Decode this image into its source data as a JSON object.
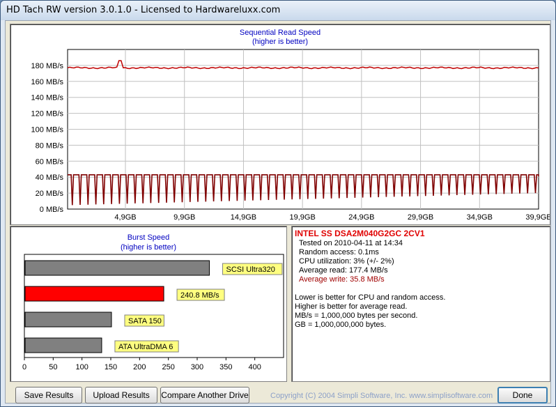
{
  "window": {
    "title": "HD Tach RW version 3.0.1.0 - Licensed to Hardwareluxx.com"
  },
  "sequential": {
    "title": "Sequential Read Speed",
    "subtitle": "(higher is better)"
  },
  "burst": {
    "title": "Burst Speed",
    "subtitle": "(higher is better)"
  },
  "info": {
    "drive_name": "INTEL SS DSA2M040G2GC 2CV1",
    "tested_on": "Tested on 2010-04-11 at 14:34",
    "random_access": "Random access: 0.1ms",
    "cpu_utilization": "CPU utilization: 3% (+/- 2%)",
    "average_read": "Average read: 177.4 MB/s",
    "average_write": "Average write: 35.8 MB/s",
    "notes": [
      "Lower is better for CPU and random access.",
      "Higher is better for average read.",
      "MB/s = 1,000,000 bytes per second.",
      "GB = 1,000,000,000 bytes."
    ]
  },
  "buttons": {
    "save": "Save Results",
    "upload": "Upload Results",
    "compare": "Compare Another Drive",
    "done": "Done"
  },
  "copyright": "Copyright (C) 2004 Simpli Software, Inc. www.simplisoftware.com",
  "colors": {
    "read": "#c00000",
    "write": "#800000",
    "bar_gray": "#808080",
    "bar_red": "#ff0000",
    "label_bg": "#ffff80"
  },
  "chart_data": [
    {
      "type": "line",
      "title": "Sequential Read Speed",
      "subtitle": "(higher is better)",
      "ylim": [
        0,
        200
      ],
      "y_ticks": [
        "0 MB/s",
        "20 MB/s",
        "40 MB/s",
        "60 MB/s",
        "80 MB/s",
        "100 MB/s",
        "120 MB/s",
        "140 MB/s",
        "160 MB/s",
        "180 MB/s"
      ],
      "x_ticks": [
        "4,9GB",
        "9,9GB",
        "14,9GB",
        "19,9GB",
        "24,9GB",
        "29,9GB",
        "34,9GB",
        "39,9GB"
      ],
      "xlim": [
        0,
        39.9
      ],
      "series": [
        {
          "read_level": 177,
          "read_spike": {
            "x": 4.5,
            "y": 186
          }
        },
        {
          "write_high": 43,
          "write_low_start": 5,
          "write_low_end": 20,
          "write_periods": 60
        }
      ]
    },
    {
      "type": "bar",
      "title": "Burst Speed",
      "subtitle": "(higher is better)",
      "xlim": [
        0,
        450
      ],
      "x_ticks": [
        "0",
        "50",
        "100",
        "150",
        "200",
        "250",
        "300",
        "350",
        "400"
      ],
      "bars": [
        {
          "label": "SCSI Ultra320",
          "value": 320,
          "highlight": false
        },
        {
          "label": "240.8 MB/s",
          "value": 240.8,
          "highlight": true
        },
        {
          "label": "SATA 150",
          "value": 150,
          "highlight": false
        },
        {
          "label": "ATA UltraDMA 6",
          "value": 133,
          "highlight": false
        }
      ]
    }
  ]
}
